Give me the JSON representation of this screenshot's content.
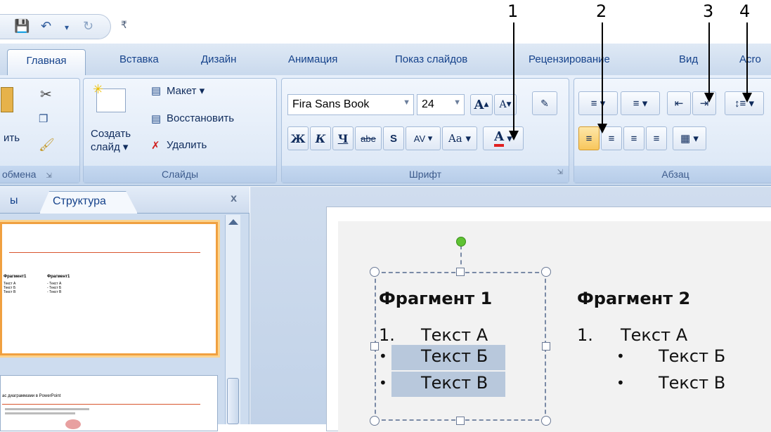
{
  "annotations": [
    "1",
    "2",
    "3",
    "4"
  ],
  "qat": {
    "undo_dropdown": "▾",
    "customize": "₹"
  },
  "tabs": [
    {
      "label": "Главная",
      "active": true
    },
    {
      "label": "Вставка"
    },
    {
      "label": "Дизайн"
    },
    {
      "label": "Анимация"
    },
    {
      "label": "Показ слайдов"
    },
    {
      "label": "Рецензирование"
    },
    {
      "label": "Вид"
    },
    {
      "label": "Acro"
    }
  ],
  "clipboard": {
    "paste_label": "ить",
    "group_label": "обмена"
  },
  "slides_group": {
    "new_slide_line1": "Создать",
    "new_slide_line2": "слайд",
    "layout": "Макет",
    "reset": "Восстановить",
    "delete": "Удалить",
    "group_label": "Слайды"
  },
  "font_group": {
    "font_name": "Fira Sans Book",
    "font_size": "24",
    "bold": "Ж",
    "italic": "К",
    "underline": "Ч",
    "strike": "abe",
    "shadow": "S",
    "spacing": "AV",
    "case": "Aa",
    "color": "A",
    "grow": "A",
    "shrink": "A",
    "group_label": "Шрифт"
  },
  "paragraph_group": {
    "group_label": "Абзац"
  },
  "colors": {
    "accent_orange": "#f0a040",
    "ribbon_blue": "#15428b",
    "handle_green": "#5fc234",
    "font_red": "#e02020"
  },
  "left_pane": {
    "tab_partial": "ы",
    "tab_structure": "Структура",
    "close": "x",
    "thumb1_col1": "Фрагмент1",
    "thumb1_col2": "Фрагмент1",
    "thumb1_items_a": [
      "Текст А",
      "Текст Б",
      "Текст В"
    ],
    "thumb1_items_b": [
      "- Текст А",
      "- Текст Б",
      "- Текст В"
    ],
    "thumb2_title": "ас диаграммами в PowerPoint"
  },
  "slide": {
    "frag1_title": "Фрагмент 1",
    "frag1_item1_num": "1.",
    "frag1_item1": "Текст А",
    "frag1_item2_bullet": "•",
    "frag1_item2": "Текст Б",
    "frag1_item3_bullet": "•",
    "frag1_item3": "Текст В",
    "frag2_title": "Фрагмент 2",
    "frag2_item1_num": "1.",
    "frag2_item1": "Текст А",
    "frag2_item2_bullet": "•",
    "frag2_item2": "Текст Б",
    "frag2_item3_bullet": "•",
    "frag2_item3": "Текст В"
  }
}
